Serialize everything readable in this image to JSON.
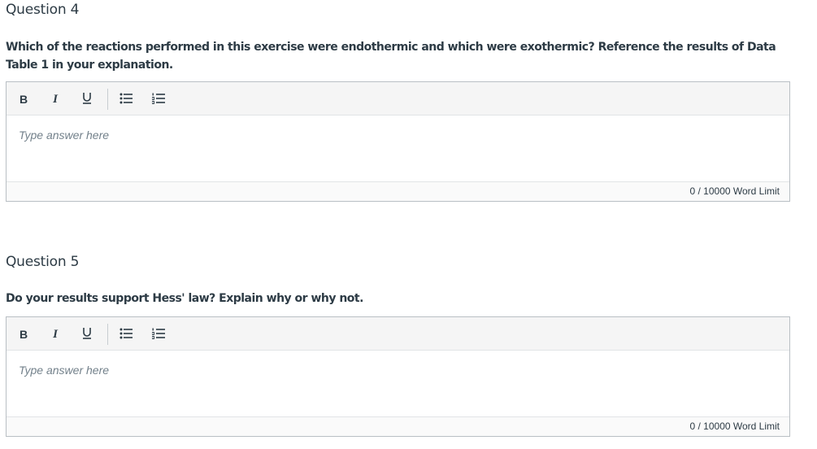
{
  "questions": [
    {
      "title": "Question 4",
      "prompt": "Which of the reactions performed in this exercise were endothermic and which were exothermic? Reference the results of Data Table 1 in your explanation.",
      "toolbar": {
        "bold": "B",
        "italic": "I",
        "underline": "U"
      },
      "placeholder": "Type answer here",
      "word_count": "0",
      "word_limit_sep": "/",
      "word_limit_text": "10000 Word Limit"
    },
    {
      "title": "Question 5",
      "prompt": "Do your results support Hess' law? Explain why or why not.",
      "toolbar": {
        "bold": "B",
        "italic": "I",
        "underline": "U"
      },
      "placeholder": "Type answer here",
      "word_count": "0",
      "word_limit_sep": "/",
      "word_limit_text": "10000 Word Limit"
    }
  ],
  "icons": {
    "bullet_list": "bulleted-list-icon",
    "numbered_list": "numbered-list-icon"
  }
}
